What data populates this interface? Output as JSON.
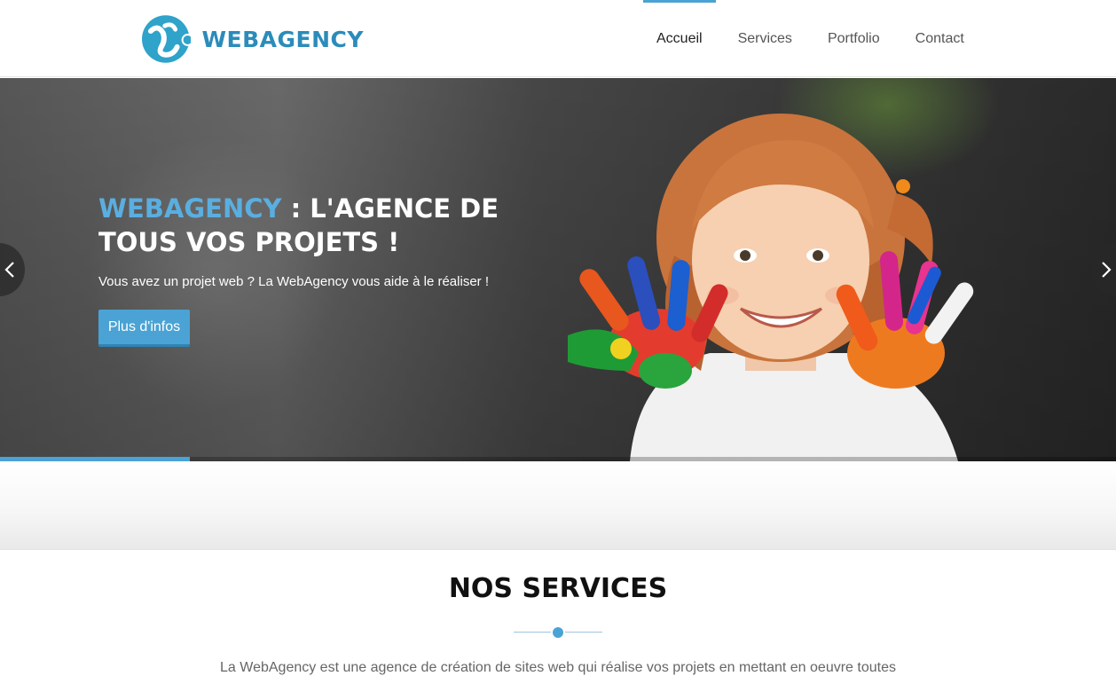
{
  "header": {
    "logo_text": "WEBAGENCY",
    "nav": [
      {
        "label": "Accueil",
        "active": true
      },
      {
        "label": "Services",
        "active": false
      },
      {
        "label": "Portfolio",
        "active": false
      },
      {
        "label": "Contact",
        "active": false
      }
    ]
  },
  "hero": {
    "title_brand": "WEBAGENCY",
    "title_rest": " : L'AGENCE DE TOUS VOS PROJETS !",
    "subtitle": "Vous avez un projet web ? La WebAgency vous aide à le réaliser !",
    "cta_label": "Plus d'infos",
    "prev_icon": "chevron-left-icon",
    "next_icon": "chevron-right-icon",
    "progress_fraction": 0.17
  },
  "services": {
    "title": "NOS SERVICES",
    "intro": "La WebAgency est une agence de création de sites web qui réalise vos projets en mettant en oeuvre toutes"
  },
  "colors": {
    "accent": "#4aa3d4",
    "brand_blue": "#2b8cba"
  }
}
